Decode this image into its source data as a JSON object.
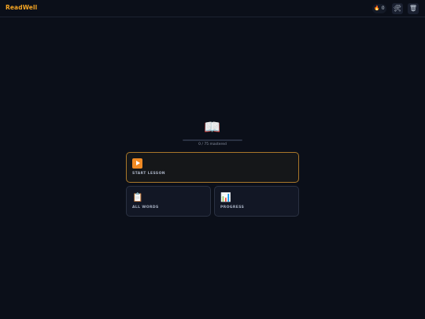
{
  "app": {
    "title": "ReadWell"
  },
  "header": {
    "streak_icon": "flame-icon",
    "streak_count": "0",
    "tools_icon": "hammer-wrench-icon",
    "trash_icon": "trash-icon"
  },
  "mastery": {
    "icon": "book-icon",
    "mastered": 0,
    "total": 75,
    "text": "0 / 75 mastered",
    "progress_fraction": 0
  },
  "actions": {
    "start": {
      "icon": "play-icon",
      "label": "START LESSON"
    },
    "words": {
      "icon": "clipboard-icon",
      "label": "ALL WORDS"
    },
    "progress": {
      "icon": "bar-chart-icon",
      "label": "PROGRESS"
    }
  },
  "colors": {
    "accent": "#f5a524",
    "background": "#0b0f19",
    "card": "#121725",
    "primary_border": "#a9772a"
  }
}
